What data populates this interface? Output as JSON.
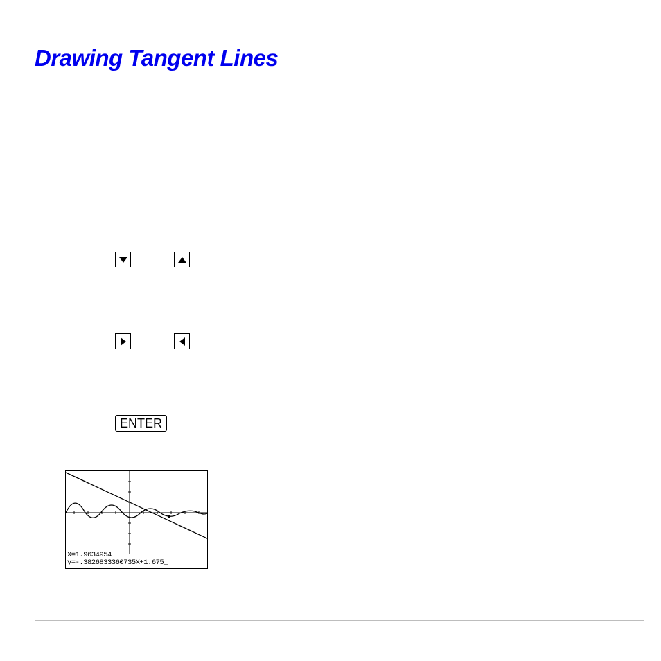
{
  "heading": "Drawing Tangent Lines",
  "keys": {
    "enter_label": "ENTER"
  },
  "screen": {
    "x_line": "X=1.9634954",
    "y_line": "y=-.3826833360735X+1.675_"
  }
}
